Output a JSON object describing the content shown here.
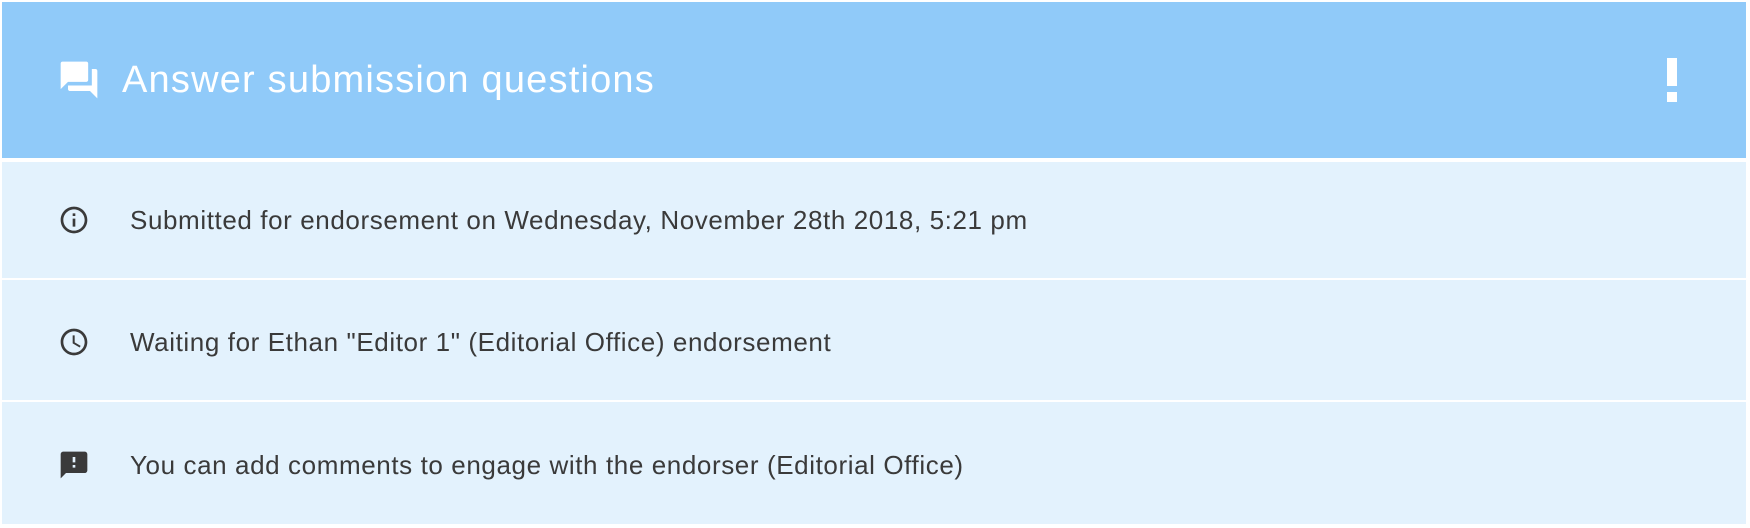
{
  "header": {
    "title": "Answer submission questions",
    "icon": "forum-icon",
    "action_icon": "exclamation-icon",
    "background": "#90caf9"
  },
  "status_rows": [
    {
      "icon": "info-icon",
      "text": "Submitted for endorsement on Wednesday, November 28th 2018, 5:21 pm"
    },
    {
      "icon": "clock-icon",
      "text": "Waiting for Ethan \"Editor 1\" (Editorial Office) endorsement"
    },
    {
      "icon": "feedback-icon",
      "text": "You can add comments to engage with the endorser (Editorial Office)"
    }
  ],
  "colors": {
    "card_background": "#e3f2fd",
    "text": "#3a3a3a",
    "header_text": "#ffffff"
  }
}
